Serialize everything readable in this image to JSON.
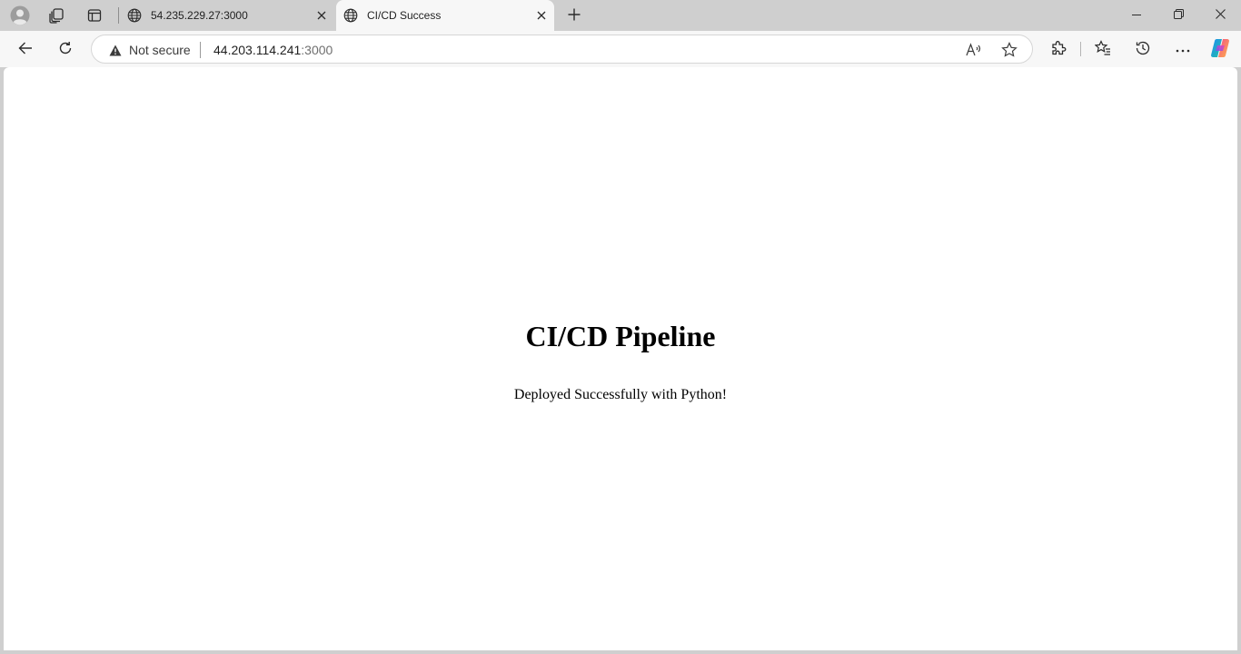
{
  "browser": {
    "tabs": [
      {
        "title": "54.235.229.27:3000",
        "favicon": "globe-icon",
        "active": false
      },
      {
        "title": "CI/CD Success",
        "favicon": "globe-icon",
        "active": true
      }
    ],
    "address_bar": {
      "security_label": "Not secure",
      "url_host": "44.203.114.241",
      "url_port": ":3000"
    },
    "icons": {
      "profile": "profile-icon",
      "workspaces": "workspaces-icon",
      "tab_actions": "tab-actions-icon",
      "new_tab": "plus-icon",
      "back": "back-arrow-icon",
      "refresh": "refresh-icon",
      "read_aloud": "read-aloud-icon",
      "favorite": "star-icon",
      "extensions": "extensions-icon",
      "favorites": "favorites-icon",
      "history": "history-icon",
      "more": "more-icon",
      "copilot": "copilot-icon"
    }
  },
  "page": {
    "heading": "CI/CD Pipeline",
    "message": "Deployed Successfully with Python!"
  }
}
